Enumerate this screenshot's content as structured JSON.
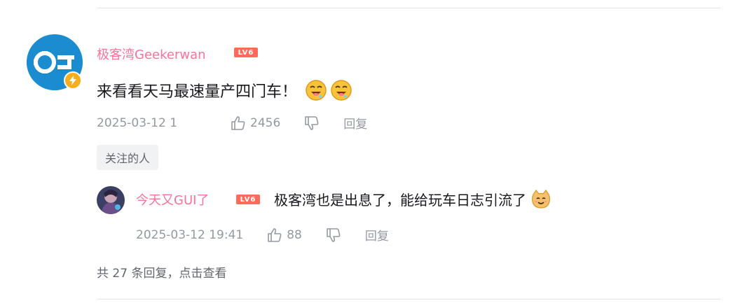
{
  "comment": {
    "username": "极客湾Geekerwan",
    "level_badge": "LV6",
    "text": "来看看天马最速量产四门车！",
    "emotes": [
      "drooling-face-icon",
      "drooling-face-icon"
    ],
    "date": "2025-03-12 1",
    "like_count": "2456",
    "reply_label": "回复",
    "tag": "关注的人"
  },
  "reply": {
    "username": "今天又GUI了",
    "level_badge": "LV6",
    "text": "极客湾也是出息了，能给玩车日志引流了",
    "emote": "cat-smile-icon",
    "date": "2025-03-12 19:41",
    "like_count": "88",
    "reply_label": "回复"
  },
  "more_replies": {
    "prefix": "共 27 条回复，",
    "link": "点击查看"
  },
  "colors": {
    "username": "#fb7299",
    "meta": "#9499a0",
    "level_badge": "#ff6a5c",
    "verify_badge": "#f6ae1c"
  }
}
